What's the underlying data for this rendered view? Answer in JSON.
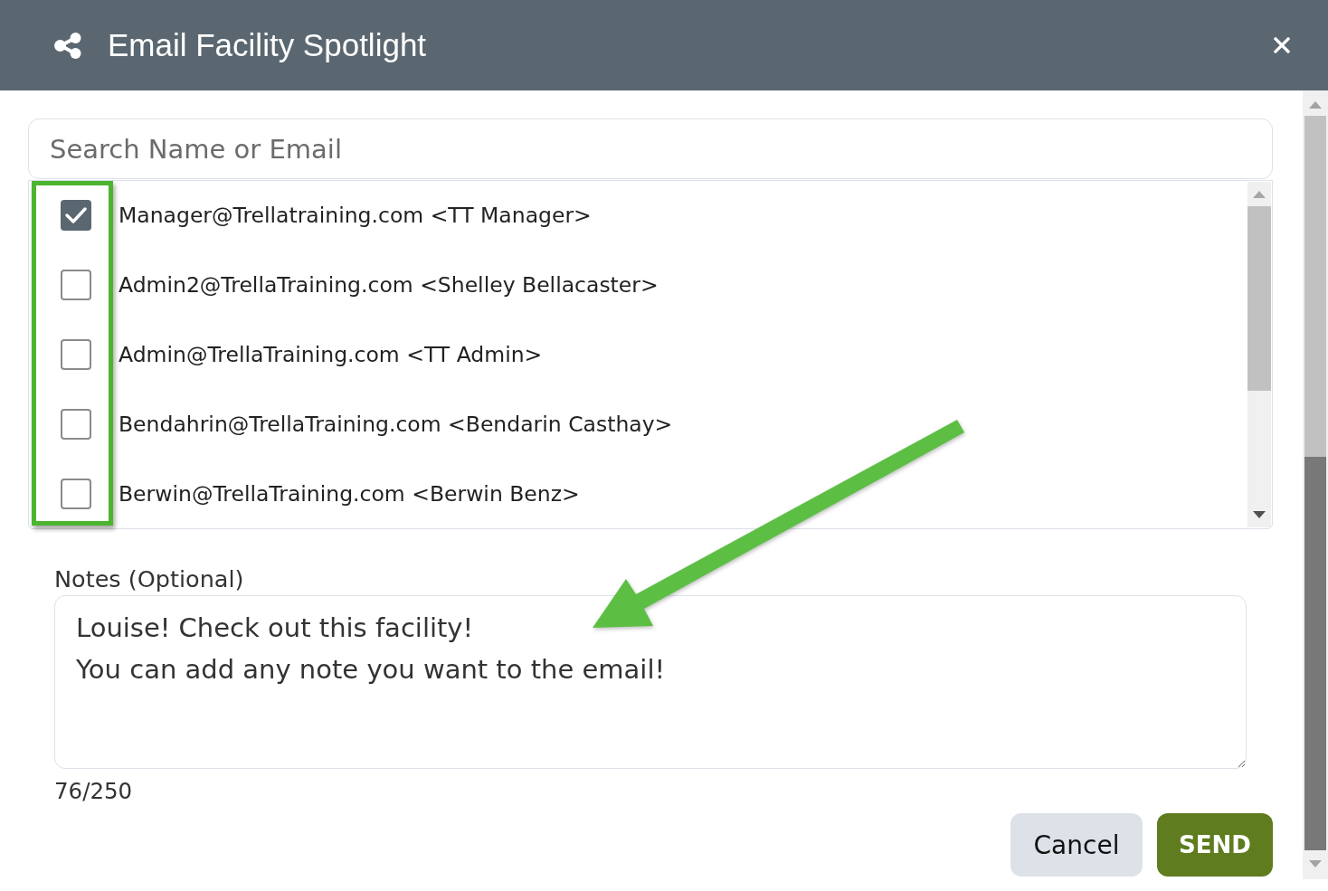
{
  "dialog": {
    "title": "Email Facility Spotlight"
  },
  "search": {
    "placeholder": "Search Name or Email"
  },
  "recipients": [
    {
      "label": "Manager@Trellatraining.com <TT Manager>",
      "checked": true
    },
    {
      "label": "Admin2@TrellaTraining.com <Shelley Bellacaster>",
      "checked": false
    },
    {
      "label": "Admin@TrellaTraining.com <TT Admin>",
      "checked": false
    },
    {
      "label": "Bendahrin@TrellaTraining.com <Bendarin Casthay>",
      "checked": false
    },
    {
      "label": "Berwin@TrellaTraining.com <Berwin Benz>",
      "checked": false
    }
  ],
  "notes": {
    "label": "Notes (Optional)",
    "value": "Louise! Check out this facility!\nYou can add any note you want to the email!",
    "counter": "76/250"
  },
  "buttons": [
    {
      "label": "Cancel",
      "kind": "secondary"
    },
    {
      "label": "SEND",
      "kind": "primary"
    }
  ],
  "annotations": {
    "checkbox_highlight": true,
    "arrow_to_notes": true
  }
}
